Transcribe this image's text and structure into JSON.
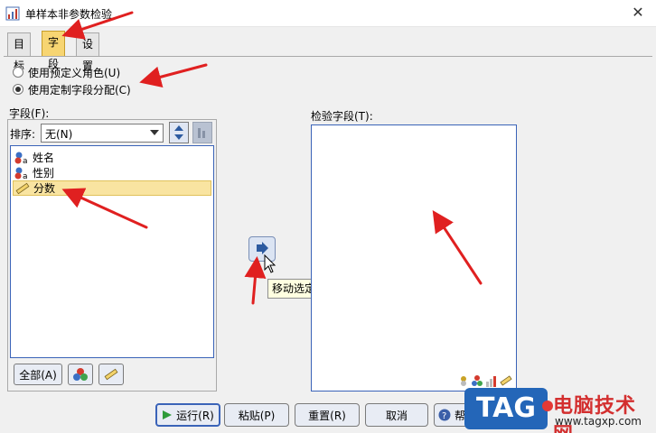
{
  "window": {
    "title": "单样本非参数检验",
    "close_glyph": "✕"
  },
  "tabs": [
    {
      "label": "目标",
      "active": false
    },
    {
      "label": "字段",
      "active": true
    },
    {
      "label": "设置",
      "active": false
    }
  ],
  "radios": [
    {
      "label": "使用预定义角色(U)",
      "checked": false
    },
    {
      "label": "使用定制字段分配(C)",
      "checked": true
    }
  ],
  "fields_panel": {
    "label": "字段(F):",
    "sort_label": "排序:",
    "sort_value": "无(N)",
    "items": [
      {
        "label": "姓名",
        "icon": "nominal-a-icon",
        "selected": false
      },
      {
        "label": "性别",
        "icon": "nominal-a-icon",
        "selected": false
      },
      {
        "label": "分数",
        "icon": "ruler-scale-icon",
        "selected": true
      }
    ],
    "buttons": {
      "all": "全部(A)"
    }
  },
  "test_fields": {
    "label": "检验字段(T):"
  },
  "tooltip": "移动选定字段至 检验字段(T) 列表",
  "actions": {
    "run": "运行(R)",
    "paste": "粘贴(P)",
    "reset": "重置(R)",
    "cancel": "取消",
    "help": "帮"
  },
  "watermark": {
    "logo": "TAG",
    "name": "电脑技术网",
    "url": "www.tagxp.com"
  },
  "colors": {
    "accent": "#3a63b8",
    "active_tab": "#f7d572",
    "selected_item": "#f9e4a1",
    "arrow": "#e02020"
  }
}
